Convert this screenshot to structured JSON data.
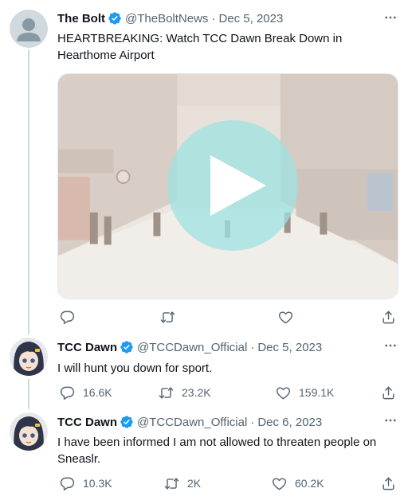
{
  "tweets": [
    {
      "name": "The Bolt",
      "handle": "@TheBoltNews",
      "date": "Dec 5, 2023",
      "text": "HEARTBREAKING: Watch TCC Dawn Break Down in Hearthome Airport",
      "reply_count": "",
      "retweet_count": "",
      "like_count": ""
    },
    {
      "name": "TCC Dawn",
      "handle": "@TCCDawn_Official",
      "date": "Dec 5, 2023",
      "text": "I will hunt you down for sport.",
      "reply_count": "16.6K",
      "retweet_count": "23.2K",
      "like_count": "159.1K"
    },
    {
      "name": "TCC Dawn",
      "handle": "@TCCDawn_Official",
      "date": "Dec 6, 2023",
      "text": "I have been informed I am not allowed to threaten people on Sneaslr.",
      "reply_count": "10.3K",
      "retweet_count": "2K",
      "like_count": "60.2K"
    }
  ],
  "separator": "·",
  "colors": {
    "text": "#0f1419",
    "secondary": "#536471",
    "verified": "#1d9bf0",
    "thread_line": "#cfd9de",
    "play_button": "#9ee1e1"
  },
  "icons": [
    "default-avatar-icon",
    "verified-badge-icon",
    "more-options-icon",
    "reply-icon",
    "retweet-icon",
    "like-icon",
    "share-icon",
    "play-icon"
  ]
}
